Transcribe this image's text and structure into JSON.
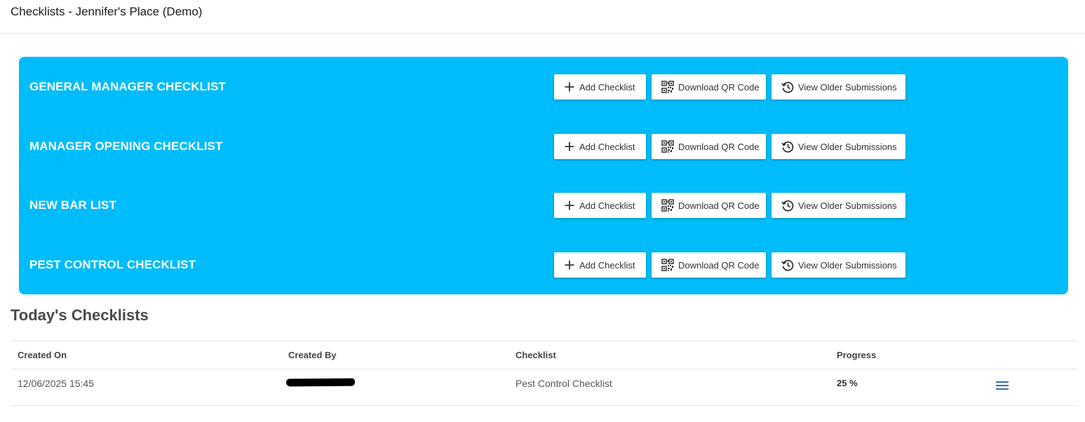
{
  "header": {
    "title": "Checklists - Jennifer's Place (Demo)"
  },
  "checklists": [
    {
      "name": "GENERAL MANAGER CHECKLIST",
      "add_label": "Add Checklist",
      "qr_label": "Download QR Code",
      "history_label": "View Older Submissions"
    },
    {
      "name": "MANAGER OPENING CHECKLIST",
      "add_label": "Add Checklist",
      "qr_label": "Download QR Code",
      "history_label": "View Older Submissions"
    },
    {
      "name": "NEW BAR LIST",
      "add_label": "Add Checklist",
      "qr_label": "Download QR Code",
      "history_label": "View Older Submissions"
    },
    {
      "name": "PEST CONTROL CHECKLIST",
      "add_label": "Add Checklist",
      "qr_label": "Download QR Code",
      "history_label": "View Older Submissions"
    }
  ],
  "today": {
    "title": "Today's Checklists",
    "columns": [
      "Created On",
      "Created By",
      "Checklist",
      "Progress"
    ],
    "rows": [
      {
        "created_on": "12/06/2025 15:45",
        "created_by": "",
        "checklist": "Pest Control Checklist",
        "progress": "25 %"
      }
    ]
  },
  "icons": {
    "add": "plus-icon",
    "qr": "qr-code-icon",
    "history": "history-icon",
    "menu": "menu-icon"
  },
  "colors": {
    "panel_background": "#00bcfb",
    "menu_icon": "#3a6fb5"
  }
}
